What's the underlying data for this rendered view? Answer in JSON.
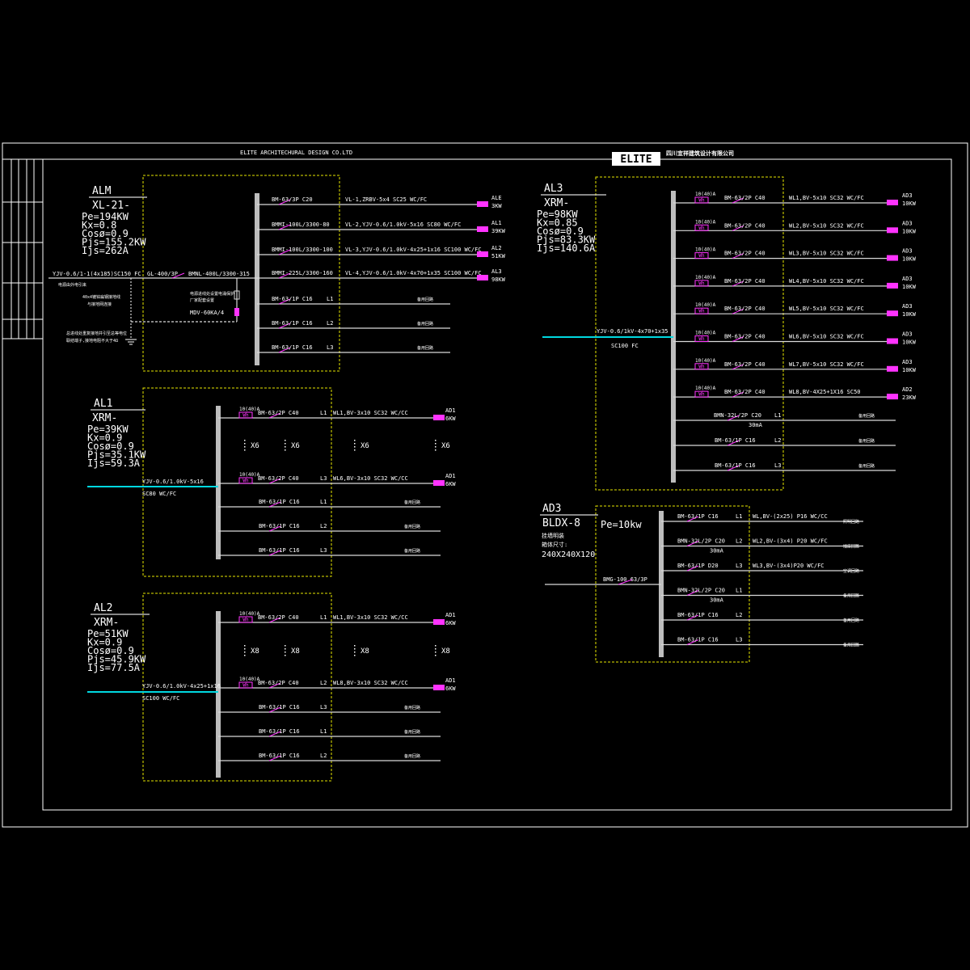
{
  "header": {
    "company_en": "ELITE ARCHITECHURAL    DESIGN   CO.LTD",
    "logo": "ELITE",
    "company_cn": "四川宜祥建筑设计有限公司"
  },
  "panels": {
    "alm": {
      "name": "ALM",
      "model": "XL-21-",
      "params": [
        "Pe=194KW",
        "Kx=0.8",
        "Cosø=0.9",
        "Pjs=155.2KW",
        "Ijs=262A"
      ],
      "incoming": "YJV-0.6/1-1(4x185)SC150 FC",
      "incoming_note": "电源由外电引来",
      "grounding_note": "40x4镀锌扁钢接地线\n与接地网连接",
      "ground_note2": "总进线处重复接地并引至总等电位\n联结端子,接地电阻不大于4Ω",
      "main_switch_left": "GL-400/3P",
      "main_switch": "BMNL-400L/3300-315",
      "spd_note": "电源进线处设置电涌保护\n厂家配套设置",
      "spd": "MDV-60KA/4",
      "branches": [
        {
          "breaker": "BM-63/3P C20",
          "cable": "VL-1,ZRBV-5x4 SC25 WC/FC",
          "dest": "ALE",
          "load": "3KW"
        },
        {
          "breaker": "BMMI-100L/3300-80",
          "cable": "VL-2,YJV-0.6/1.0kV-5x16 SC80 WC/FC",
          "dest": "AL1",
          "load": "39KW"
        },
        {
          "breaker": "BMMI-100L/3300-100",
          "cable": "VL-3,YJV-0.6/1.0kV-4x25+1x16 SC100 WC/FC",
          "dest": "AL2",
          "load": "51KW"
        },
        {
          "breaker": "BMMI-225L/3300-160",
          "cable": "VL-4,YJV-0.6/1.0kV-4x70+1x35 SC100 WC/FC",
          "dest": "AL3",
          "load": "98KW"
        },
        {
          "breaker": "BM-63/1P C16",
          "phase": "L1",
          "note": "备用回路"
        },
        {
          "breaker": "BM-63/1P C16",
          "phase": "L2",
          "note": "备用回路"
        },
        {
          "breaker": "BM-63/1P C16",
          "phase": "L3",
          "note": "备用回路"
        }
      ]
    },
    "al1": {
      "name": "AL1",
      "model": "XRM-",
      "params": [
        "Pe=39KW",
        "Kx=0.9",
        "Cosø=0.9",
        "Pjs=35.1KW",
        "Ijs=59.3A"
      ],
      "incoming": "YJV-0.6/1.0kV-5x16",
      "incoming2": "SC80 WC/FC",
      "meter": "10(40)A",
      "meter_label": "Wh",
      "first": {
        "breaker": "BM-63/2P C40",
        "phase": "L1",
        "cable": "WL1,BV-3x10 SC32 WC/CC",
        "dest": "AD1",
        "load": "6KW"
      },
      "repeat": "X6",
      "last": {
        "breaker": "BM-63/2P C40",
        "phase": "L3",
        "cable": "WL6,BV-3x10 SC32 WC/CC",
        "dest": "AD1",
        "load": "6KW"
      },
      "spares": [
        {
          "breaker": "BM-63/1P C16",
          "phase": "L1",
          "note": "备用回路"
        },
        {
          "breaker": "BM-63/1P C16",
          "phase": "L2",
          "note": "备用回路"
        },
        {
          "breaker": "BM-63/1P C16",
          "phase": "L3",
          "note": "备用回路"
        }
      ]
    },
    "al2": {
      "name": "AL2",
      "model": "XRM-",
      "params": [
        "Pe=51KW",
        "Kx=0.9",
        "Cosø=0.9",
        "Pjs=45.9KW",
        "Ijs=77.5A"
      ],
      "incoming": "YJV-0.6/1.0kV-4x25+1x16",
      "incoming2": "SC100 WC/FC",
      "meter": "10(40)A",
      "meter_label": "Wh",
      "first": {
        "breaker": "BM-63/2P C40",
        "phase": "L1",
        "cable": "WL1,BV-3x10 SC32 WC/CC",
        "dest": "AD1",
        "load": "6KW"
      },
      "repeat": "X8",
      "last": {
        "breaker": "BM-63/2P C40",
        "phase": "L2",
        "cable": "WL8,BV-3x10 SC32 WC/CC",
        "dest": "AD1",
        "load": "6KW"
      },
      "spares": [
        {
          "breaker": "BM-63/1P C16",
          "phase": "L3",
          "note": "备用回路"
        },
        {
          "breaker": "BM-63/1P C16",
          "phase": "L1",
          "note": "备用回路"
        },
        {
          "breaker": "BM-63/1P C16",
          "phase": "L2",
          "note": "备用回路"
        }
      ]
    },
    "al3": {
      "name": "AL3",
      "model": "XRM-",
      "params": [
        "Pe=98KW",
        "Kx=0.85",
        "Cosø=0.9",
        "Pjs=83.3KW",
        "Ijs=140.6A"
      ],
      "incoming": "YJV-0.6/1kV-4x70+1x35",
      "incoming2": "SC100 FC",
      "meter": "10(40)A",
      "meter_label": "Wh",
      "branches": [
        {
          "breaker": "BM-63/2P C40",
          "cable": "WL1,BV-5x10 SC32 WC/FC",
          "dest": "AD3",
          "load": "10KW"
        },
        {
          "breaker": "BM-63/2P C40",
          "cable": "WL2,BV-5x10 SC32 WC/FC",
          "dest": "AD3",
          "load": "10KW"
        },
        {
          "breaker": "BM-63/2P C40",
          "cable": "WL3,BV-5x10 SC32 WC/FC",
          "dest": "AD3",
          "load": "10KW"
        },
        {
          "breaker": "BM-63/2P C40",
          "cable": "WL4,BV-5x10 SC32 WC/FC",
          "dest": "AD3",
          "load": "10KW"
        },
        {
          "breaker": "BM-63/2P C40",
          "cable": "WL5,BV-5x10 SC32 WC/FC",
          "dest": "AD3",
          "load": "10KW"
        },
        {
          "breaker": "BM-63/2P C40",
          "cable": "WL6,BV-5x10 SC32 WC/FC",
          "dest": "AD3",
          "load": "10KW"
        },
        {
          "breaker": "BM-63/2P C40",
          "cable": "WL7,BV-5x10 SC32 WC/FC",
          "dest": "AD3",
          "load": "10KW"
        },
        {
          "breaker": "BM-63/2P C40",
          "cable": "WL8,BV-4X25+1X16 SC50",
          "dest": "AD2",
          "load": "23KW"
        }
      ],
      "spares": [
        {
          "breaker": "BMN-32L/2P C20",
          "phase": "L1",
          "extra": "30mA",
          "note": "备用回路"
        },
        {
          "breaker": "BM-63/1P C16",
          "phase": "L2",
          "note": "备用回路"
        },
        {
          "breaker": "BM-63/1P C16",
          "phase": "L3",
          "note": "备用回路"
        }
      ]
    },
    "ad3": {
      "name": "AD3",
      "model": "BLDX-8",
      "pe": "Pe=10kw",
      "note1": "挂墙明装",
      "note2": "箱体尺寸:",
      "size": "240X240X120",
      "main_switch": "BMG-100 63/3P",
      "branches": [
        {
          "breaker": "BM-63/1P C16",
          "phase": "L1",
          "cable": "WL,BV-(2x25) P16 WC/CC",
          "note": "照明回路"
        },
        {
          "breaker": "BMN-32L/2P C20",
          "phase": "L2",
          "extra": "30mA",
          "cable": "WL2,BV-(3x4) P20 WC/FC",
          "note": "插座回路"
        },
        {
          "breaker": "BM-63/1P D20",
          "phase": "L3",
          "cable": "WL3,BV-(3x4)P20 WC/FC",
          "note": "空调回路"
        },
        {
          "breaker": "BMN-32L/2P C20",
          "phase": "L1",
          "extra": "30mA",
          "note": "备用回路"
        },
        {
          "breaker": "BM-63/1P C16",
          "phase": "L2",
          "note": "备用回路"
        },
        {
          "breaker": "BM-63/1P C16",
          "phase": "L3",
          "note": "备用回路"
        }
      ]
    }
  }
}
